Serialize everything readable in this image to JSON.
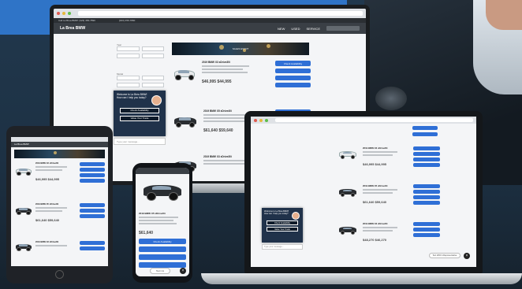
{
  "site": {
    "brand": "La Brea BMW",
    "topbar": "Call La Brea BMW: (323) 456-7890",
    "phone": "(323) 456-7890",
    "nav": [
      "NEW",
      "USED",
      "SERVICE"
    ]
  },
  "filters": {
    "year_label": "Year",
    "model_label": "Model"
  },
  "banner": {
    "text": "SALES EVENT"
  },
  "vehicles": [
    {
      "title": "2019 BMW X3 sDrive30i",
      "price": "$46,995  $44,995",
      "cta": "Check Availability"
    },
    {
      "title": "2019 BMW X5 xDrive40i",
      "price": "$61,640  $59,640",
      "cta": "Check Availability"
    },
    {
      "title": "2019 BMW X3 xDrive30i",
      "price": "$48,270  $46,270",
      "cta": "Check Availability"
    }
  ],
  "chat": {
    "message": "Welcome to La Brea BMW! How can I help you today?",
    "btn1": "Check Availability",
    "btn2": "Value Your Trade",
    "input_placeholder": "Type your message...",
    "invite": "Text With A Representative"
  },
  "phone_view": {
    "title": "2019 BMW X5 xDrive40i",
    "price": "$61,640",
    "btn": "Check Availability",
    "bottom": "Text Us"
  },
  "colors": {
    "accent": "#2f6fd6",
    "chat_bg": "#20324a",
    "nav_bg": "#3a3f45"
  },
  "icons": {
    "close": "close-icon",
    "avatar": "agent-avatar"
  }
}
